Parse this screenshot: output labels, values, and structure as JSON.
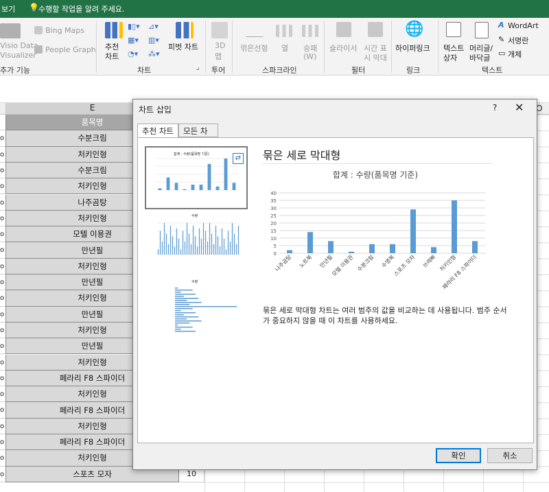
{
  "titlebar": {
    "left_fragment": "보기",
    "tell_me": "수행할 작업을 알려 주세요."
  },
  "ribbon": {
    "visio_line1": "Visio Data",
    "visio_line2": "Visualizer",
    "bing_maps": "Bing Maps",
    "people_graph": "People Graph",
    "addins_group": "추가 기능",
    "recommended_charts_line1": "추천",
    "recommended_charts_line2": "차트",
    "pivot_chart": "피벗 차트",
    "chart_group": "차트",
    "map3d_line1": "3D",
    "map3d_line2": "맵",
    "tour_group": "투어",
    "sparkline_line": "꺾은선형",
    "sparkline_column": "열",
    "sparkline_winloss_line1": "승패",
    "sparkline_winloss_line2": "(W)",
    "sparkline_group": "스파크라인",
    "slicer": "슬라이서",
    "timeline_line1": "시간 표",
    "timeline_line2": "시 막대",
    "filter_group": "필터",
    "hyperlink": "하이퍼링크",
    "link_group": "링크",
    "textbox_line1": "텍스트",
    "textbox_line2": "상자",
    "header_line1": "머리글/",
    "header_line2": "바닥글",
    "wordart": "WordArt",
    "signature": "서명란",
    "object": "개체",
    "text_group": "텍스트"
  },
  "sheet": {
    "column_e": "E",
    "column_o": "O",
    "header_cell": "품목명",
    "rows": [
      "수분크림",
      "처키인형",
      "수분크림",
      "처키인형",
      "나주곰탕",
      "처키인형",
      "모텔 이용권",
      "만년필",
      "처키인형",
      "만년필",
      "처키인형",
      "만년필",
      "처키인형",
      "만년필",
      "처키인형",
      "페라리 F8 스파이더",
      "처키인형",
      "페라리 F8 스파이더",
      "처키인형",
      "페라리 F8 스파이더",
      "처키인형",
      "스포츠 모자"
    ],
    "left_prefix": "o",
    "last_row_value": "10"
  },
  "dialog": {
    "title": "차트 삽입",
    "help": "?",
    "close": "✕",
    "tab_recommended": "추천 차트",
    "tab_all": "모든 차트",
    "chart_type_title": "묶은 세로 막대형",
    "description": "묶은 세로 막대형 차트는 여러 범주의 값을 비교하는 데 사용됩니다. 범주 순서가 중요하지 않을 때 이 차트를 사용하세요.",
    "ok": "확인",
    "cancel": "취소",
    "thumb1_title": "합계 : 수량(품목명 기준)",
    "thumb2_title": "수량",
    "thumb3_title": "수량"
  },
  "chart_data": {
    "type": "bar",
    "title": "합계 : 수량(품목명 기준)",
    "categories": [
      "나주곰탕",
      "노트북",
      "만년필",
      "모텔 이용권",
      "수분크림",
      "수영복",
      "스포츠 모자",
      "쓰레빠",
      "처키인형",
      "페라리 F8 스파이더"
    ],
    "values": [
      2,
      14,
      8,
      1,
      6,
      6,
      29,
      4,
      35,
      8
    ],
    "ylim": [
      0,
      40
    ],
    "yticks": [
      0,
      5,
      10,
      15,
      20,
      25,
      30,
      35,
      40
    ],
    "grid": true,
    "color": "#5b9bd5"
  }
}
